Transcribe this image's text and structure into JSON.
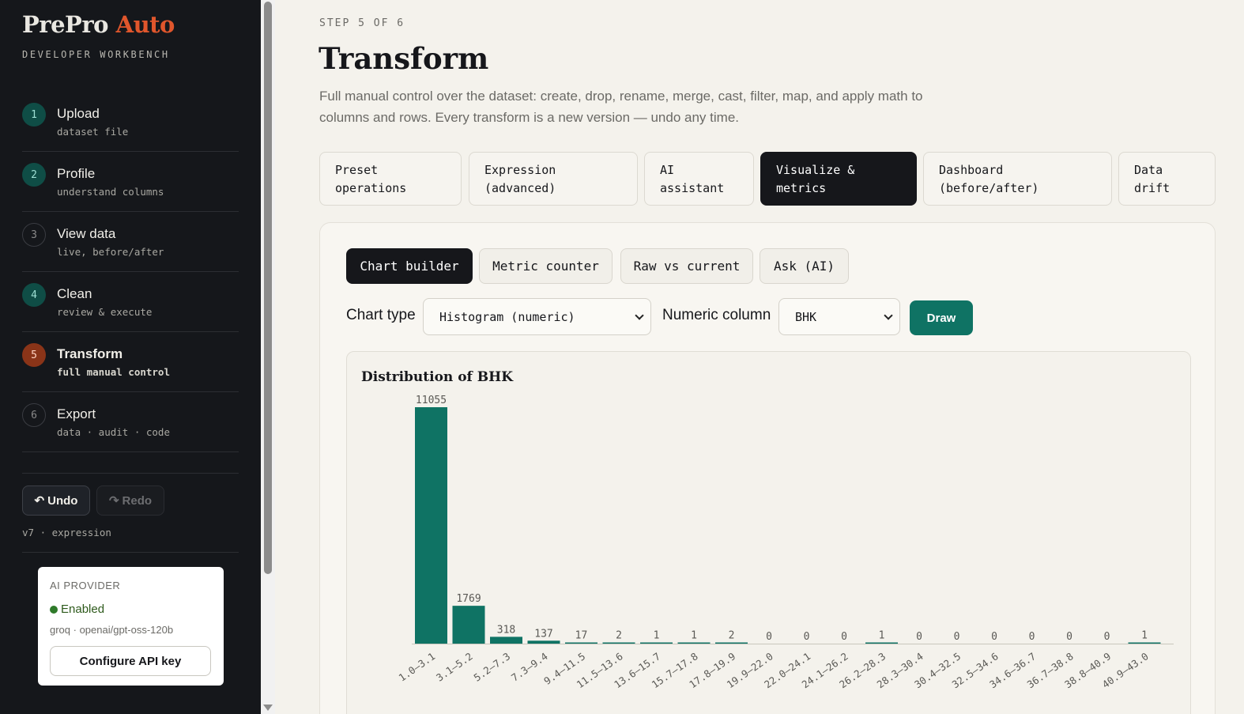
{
  "brand": {
    "name": "PrePro",
    "accent": "Auto",
    "subtitle": "DEVELOPER WORKBENCH"
  },
  "steps": [
    {
      "num": "1",
      "title": "Upload",
      "sub": "dataset file",
      "state": "done"
    },
    {
      "num": "2",
      "title": "Profile",
      "sub": "understand columns",
      "state": "done"
    },
    {
      "num": "3",
      "title": "View data",
      "sub": "live, before/after",
      "state": "pending"
    },
    {
      "num": "4",
      "title": "Clean",
      "sub": "review & execute",
      "state": "done"
    },
    {
      "num": "5",
      "title": "Transform",
      "sub": "full manual control",
      "state": "active"
    },
    {
      "num": "6",
      "title": "Export",
      "sub": "data · audit · code",
      "state": "pending"
    }
  ],
  "history": {
    "undo": "Undo",
    "redo": "Redo",
    "version": "v7 · expression"
  },
  "ai_provider": {
    "label": "AI PROVIDER",
    "status": "Enabled",
    "model": "groq · openai/gpt-oss-120b",
    "configure": "Configure API key"
  },
  "main": {
    "step_label": "STEP 5 OF 6",
    "title": "Transform",
    "description": "Full manual control over the dataset: create, drop, rename, merge, cast, filter, map, and apply math to columns and rows. Every transform is a new version — undo any time.",
    "tabs": [
      {
        "line1": "Preset",
        "line2": "operations"
      },
      {
        "line1": "Expression",
        "line2": "(advanced)"
      },
      {
        "line1": "AI",
        "line2": "assistant"
      },
      {
        "line1": "Visualize &",
        "line2": "metrics"
      },
      {
        "line1": "Dashboard",
        "line2": "(before/after)"
      },
      {
        "line1": "Data",
        "line2": "drift"
      }
    ],
    "subtabs": [
      "Chart builder",
      "Metric counter",
      "Raw vs current",
      "Ask (AI)"
    ],
    "controls": {
      "chart_type_label": "Chart type",
      "chart_type_value": "Histogram (numeric)",
      "numeric_column_label": "Numeric column",
      "numeric_column_value": "BHK",
      "draw": "Draw"
    }
  },
  "colors": {
    "accent": "#0f7364",
    "brand_accent": "#e0562c",
    "sidebar_bg": "#15171b"
  },
  "chart_data": {
    "type": "bar",
    "title": "Distribution of BHK",
    "categories": [
      "1.0–3.1",
      "3.1–5.2",
      "5.2–7.3",
      "7.3–9.4",
      "9.4–11.5",
      "11.5–13.6",
      "13.6–15.7",
      "15.7–17.8",
      "17.8–19.9",
      "19.9–22.0",
      "22.0–24.1",
      "24.1–26.2",
      "26.2–28.3",
      "28.3–30.4",
      "30.4–32.5",
      "32.5–34.6",
      "34.6–36.7",
      "36.7–38.8",
      "38.8–40.9",
      "40.9–43.0"
    ],
    "values": [
      11055,
      1769,
      318,
      137,
      17,
      2,
      1,
      1,
      2,
      0,
      0,
      0,
      1,
      0,
      0,
      0,
      0,
      0,
      0,
      1
    ],
    "color": "#0f7364",
    "ylim": [
      0,
      11055
    ]
  }
}
